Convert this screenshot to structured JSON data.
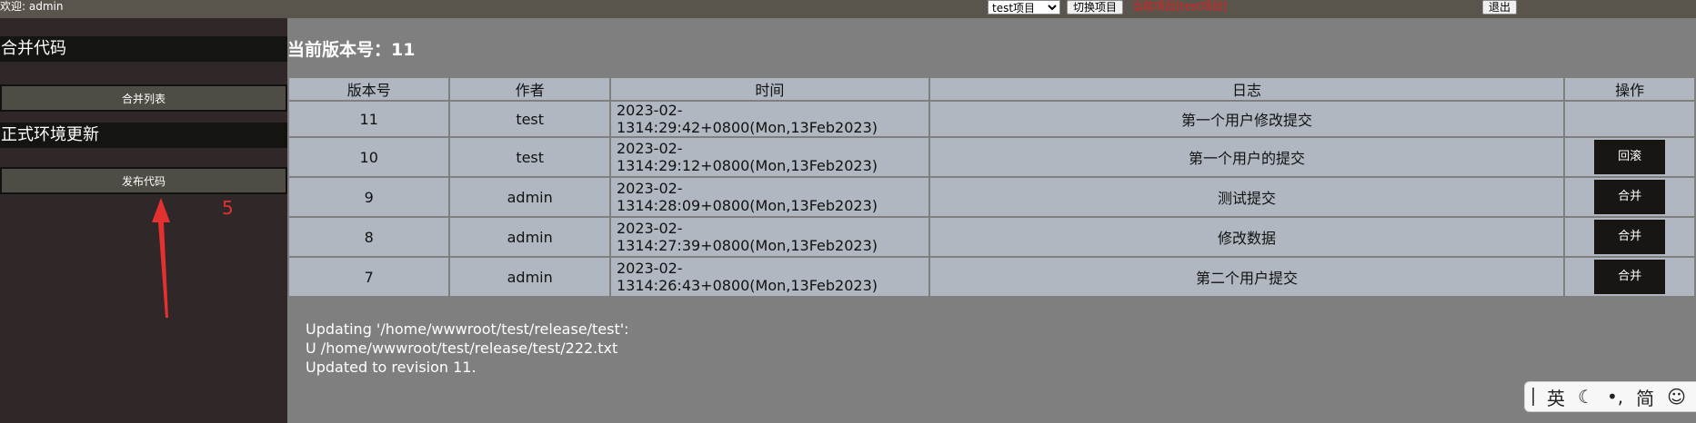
{
  "topbar": {
    "welcome": "欢迎: admin",
    "project_select_value": "test项目",
    "switch_button": "切换项目",
    "current_project_label": "当前项目[test项目]",
    "logout_button": "退出"
  },
  "sidebar": {
    "merge_section_title": "合并代码",
    "merge_list_button": "合并列表",
    "release_section_title": "正式环境更新",
    "publish_button": "发布代码"
  },
  "annotation": {
    "number": "5"
  },
  "main": {
    "version_title": "当前版本号：11",
    "columns": [
      "版本号",
      "作者",
      "时间",
      "日志",
      "操作"
    ],
    "rows": [
      {
        "version": "11",
        "author": "test",
        "time": "2023-02-1314:29:42+0800(Mon,13Feb2023)",
        "log": "第一个用户修改提交",
        "action": ""
      },
      {
        "version": "10",
        "author": "test",
        "time": "2023-02-1314:29:12+0800(Mon,13Feb2023)",
        "log": "第一个用户的提交",
        "action": "回滚"
      },
      {
        "version": "9",
        "author": "admin",
        "time": "2023-02-1314:28:09+0800(Mon,13Feb2023)",
        "log": "测试提交",
        "action": "合并"
      },
      {
        "version": "8",
        "author": "admin",
        "time": "2023-02-1314:27:39+0800(Mon,13Feb2023)",
        "log": "修改数据",
        "action": "合并"
      },
      {
        "version": "7",
        "author": "admin",
        "time": "2023-02-1314:26:43+0800(Mon,13Feb2023)",
        "log": "第二个用户提交",
        "action": "合并"
      }
    ],
    "output_lines": [
      "Updating '/home/wwwroot/test/release/test':",
      "U /home/wwwroot/test/release/test/222.txt",
      "Updated to revision 11."
    ]
  },
  "ime_bar": {
    "lang": "英",
    "mode_icon": "moon-icon",
    "punct": "•,",
    "script": "简",
    "emoji_icon": "smile-icon"
  },
  "colors": {
    "topbar": "#59554c",
    "sidebar": "#302828",
    "table_cell": "#b1b7c1",
    "annotation": "#e53030"
  }
}
